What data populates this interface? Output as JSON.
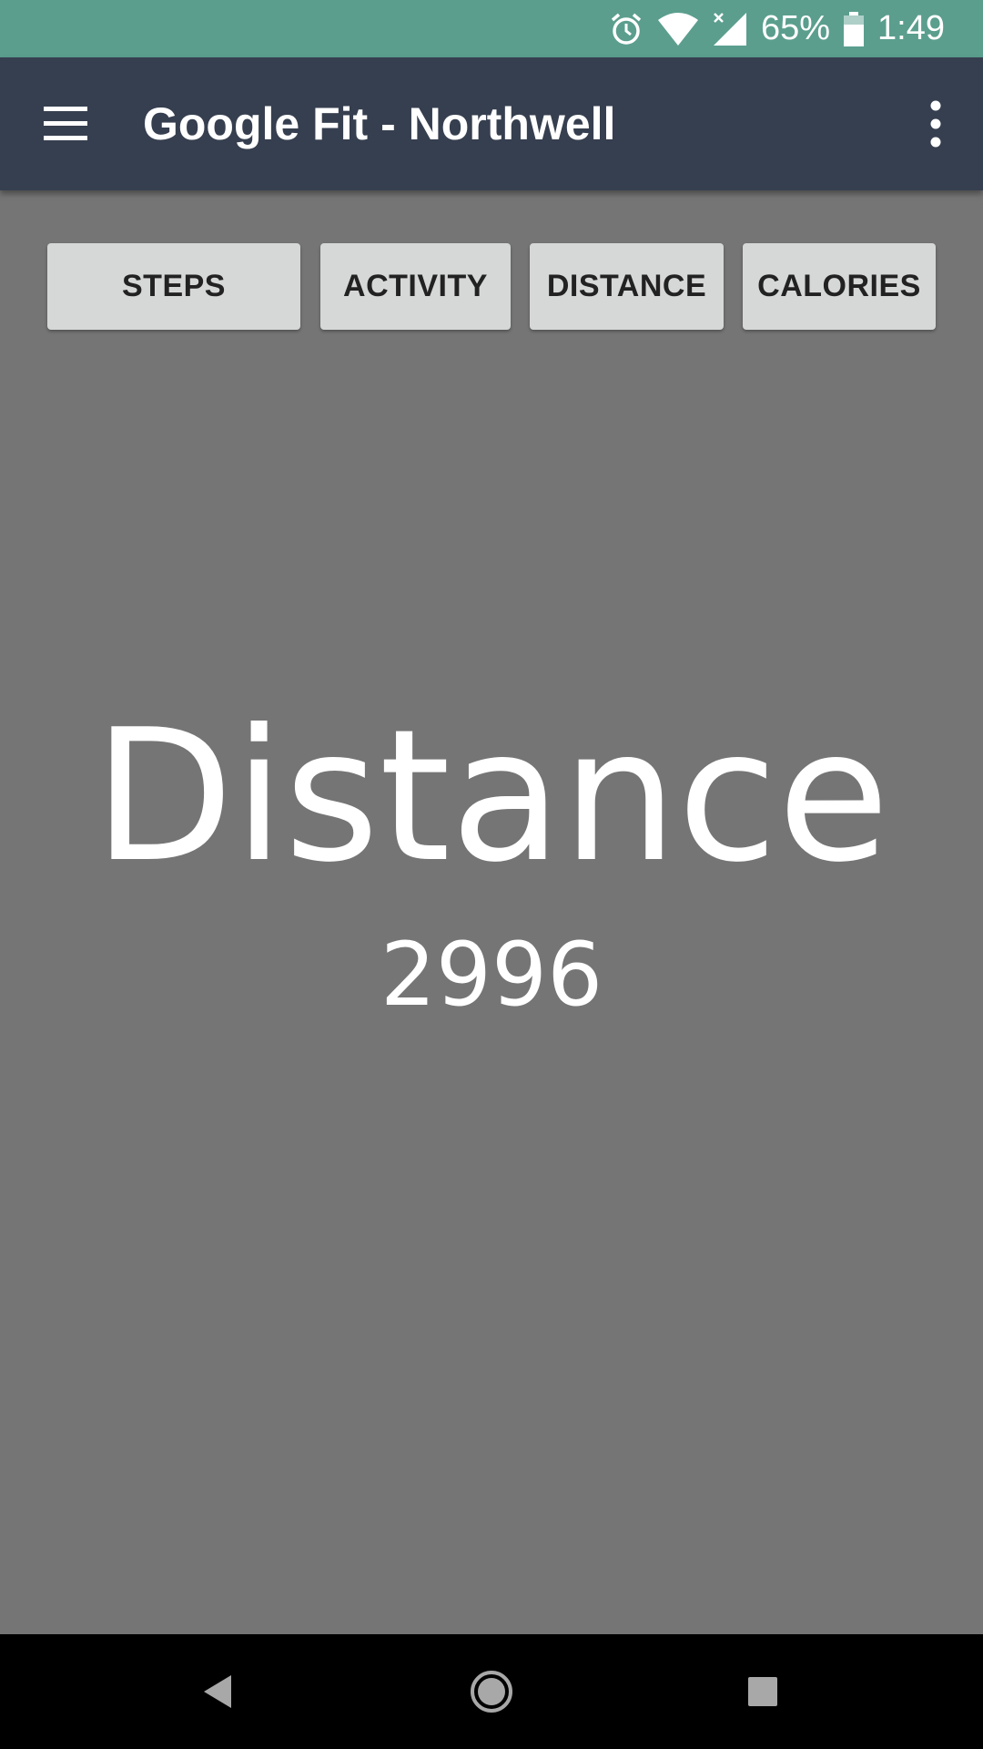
{
  "status_bar": {
    "battery_percent": "65%",
    "time": "1:49",
    "icons": [
      "alarm-icon",
      "wifi-icon",
      "signal-icon",
      "battery-icon"
    ]
  },
  "app_bar": {
    "title": "Google Fit - Northwell",
    "menu_icon": "hamburger-menu-icon",
    "overflow_icon": "more-vert-icon"
  },
  "tabs": [
    {
      "label": "STEPS"
    },
    {
      "label": "ACTIVITY"
    },
    {
      "label": "DISTANCE"
    },
    {
      "label": "CALORIES"
    }
  ],
  "metric": {
    "label": "Distance",
    "value": "2996"
  },
  "nav_bar": {
    "icons": [
      "back-icon",
      "home-icon",
      "recents-icon"
    ]
  },
  "colors": {
    "status_bar": "#5b9e8e",
    "app_bar": "#363f4f",
    "background": "#757575",
    "button": "#d6d7d7"
  }
}
